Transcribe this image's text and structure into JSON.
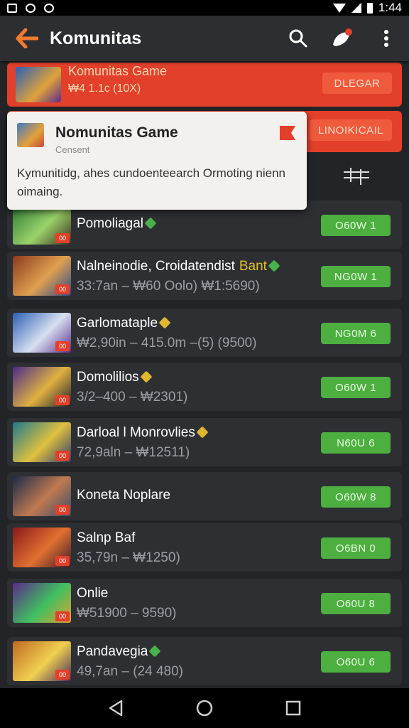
{
  "status_bar": {
    "time": "1:44"
  },
  "app_bar": {
    "title": "Komunitas"
  },
  "promos": [
    {
      "title": "Komunitas Game",
      "subtitle": "₩4 1.1c (10X)",
      "button": "DLEGAR"
    },
    {
      "button": "LINOIKICAIL"
    }
  ],
  "popup": {
    "title": "Nomunitas Game",
    "subtitle": "Censent",
    "body": "Kymunitidg, ahes cundoenteearch Ormoting nienn oimaing."
  },
  "games": [
    {
      "title": "Pomoliagal",
      "subtitle": "",
      "button": "O60W 1",
      "gem": "#47b24a",
      "art": [
        "#2a7a34",
        "#9bd36a",
        "#3a2a1e"
      ]
    },
    {
      "title": "Nalneinodie, Croidatendist",
      "title_extra": "Bant",
      "subtitle": "33:7an – ₩60 Oolo) ₩1:5690)",
      "button": "NG0W 1",
      "gem": "#47b24a",
      "art": [
        "#8a3a1c",
        "#e0a050",
        "#2a4a8a"
      ]
    },
    {
      "title": "Garlomataple",
      "subtitle": "₩2,90in – 415.0m –(5) (9500)",
      "button": "NG0M 6",
      "gem": "#e0b830",
      "art": [
        "#2b5fb5",
        "#d8e0f0",
        "#5a2c8a"
      ]
    },
    {
      "title": "Domolilios",
      "subtitle": "3/2–400 – ₩2301)",
      "button": "O60W 1",
      "gem": "#e0b830",
      "art": [
        "#4a2c8a",
        "#e0b040",
        "#202030"
      ]
    },
    {
      "title": "Darloal l Monrovlies",
      "subtitle": "72,9aln – ₩12511)",
      "button": "N60U 6",
      "gem": "#e0b830",
      "art": [
        "#1e7a8a",
        "#e0c040",
        "#2a3a6a"
      ]
    },
    {
      "title": "Koneta Noplare",
      "subtitle": "",
      "button": "O60W 8",
      "gem": "",
      "art": [
        "#1a2a4a",
        "#c07a50",
        "#3a4a6a"
      ]
    },
    {
      "title": "Salnp Baf",
      "subtitle": "35,79n – ₩1250)",
      "button": "O6BN 0",
      "gem": "",
      "art": [
        "#8a1a1a",
        "#e07030",
        "#3a1a2a"
      ]
    },
    {
      "title": "Onlie",
      "subtitle": "₩51900 – 9590)",
      "button": "O60U 8",
      "gem": "",
      "art": [
        "#5a2a8a",
        "#40c060",
        "#e0a030"
      ]
    },
    {
      "title": "Pandavegia",
      "subtitle": "49,7an – (24 480)",
      "button": "O60U 6",
      "gem": "#47b24a",
      "art": [
        "#c06a20",
        "#f0d050",
        "#4a2a5a"
      ]
    }
  ]
}
